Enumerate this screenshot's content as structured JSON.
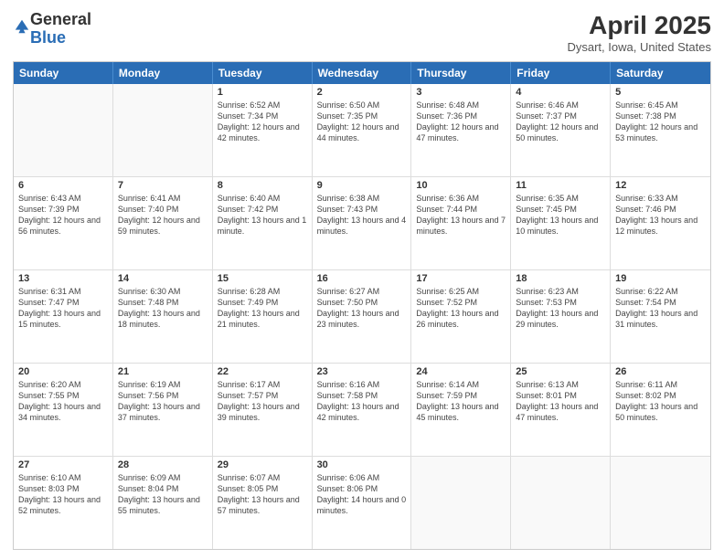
{
  "logo": {
    "general": "General",
    "blue": "Blue"
  },
  "title": "April 2025",
  "subtitle": "Dysart, Iowa, United States",
  "headers": [
    "Sunday",
    "Monday",
    "Tuesday",
    "Wednesday",
    "Thursday",
    "Friday",
    "Saturday"
  ],
  "rows": [
    [
      {
        "day": "",
        "info": ""
      },
      {
        "day": "",
        "info": ""
      },
      {
        "day": "1",
        "info": "Sunrise: 6:52 AM\nSunset: 7:34 PM\nDaylight: 12 hours and 42 minutes."
      },
      {
        "day": "2",
        "info": "Sunrise: 6:50 AM\nSunset: 7:35 PM\nDaylight: 12 hours and 44 minutes."
      },
      {
        "day": "3",
        "info": "Sunrise: 6:48 AM\nSunset: 7:36 PM\nDaylight: 12 hours and 47 minutes."
      },
      {
        "day": "4",
        "info": "Sunrise: 6:46 AM\nSunset: 7:37 PM\nDaylight: 12 hours and 50 minutes."
      },
      {
        "day": "5",
        "info": "Sunrise: 6:45 AM\nSunset: 7:38 PM\nDaylight: 12 hours and 53 minutes."
      }
    ],
    [
      {
        "day": "6",
        "info": "Sunrise: 6:43 AM\nSunset: 7:39 PM\nDaylight: 12 hours and 56 minutes."
      },
      {
        "day": "7",
        "info": "Sunrise: 6:41 AM\nSunset: 7:40 PM\nDaylight: 12 hours and 59 minutes."
      },
      {
        "day": "8",
        "info": "Sunrise: 6:40 AM\nSunset: 7:42 PM\nDaylight: 13 hours and 1 minute."
      },
      {
        "day": "9",
        "info": "Sunrise: 6:38 AM\nSunset: 7:43 PM\nDaylight: 13 hours and 4 minutes."
      },
      {
        "day": "10",
        "info": "Sunrise: 6:36 AM\nSunset: 7:44 PM\nDaylight: 13 hours and 7 minutes."
      },
      {
        "day": "11",
        "info": "Sunrise: 6:35 AM\nSunset: 7:45 PM\nDaylight: 13 hours and 10 minutes."
      },
      {
        "day": "12",
        "info": "Sunrise: 6:33 AM\nSunset: 7:46 PM\nDaylight: 13 hours and 12 minutes."
      }
    ],
    [
      {
        "day": "13",
        "info": "Sunrise: 6:31 AM\nSunset: 7:47 PM\nDaylight: 13 hours and 15 minutes."
      },
      {
        "day": "14",
        "info": "Sunrise: 6:30 AM\nSunset: 7:48 PM\nDaylight: 13 hours and 18 minutes."
      },
      {
        "day": "15",
        "info": "Sunrise: 6:28 AM\nSunset: 7:49 PM\nDaylight: 13 hours and 21 minutes."
      },
      {
        "day": "16",
        "info": "Sunrise: 6:27 AM\nSunset: 7:50 PM\nDaylight: 13 hours and 23 minutes."
      },
      {
        "day": "17",
        "info": "Sunrise: 6:25 AM\nSunset: 7:52 PM\nDaylight: 13 hours and 26 minutes."
      },
      {
        "day": "18",
        "info": "Sunrise: 6:23 AM\nSunset: 7:53 PM\nDaylight: 13 hours and 29 minutes."
      },
      {
        "day": "19",
        "info": "Sunrise: 6:22 AM\nSunset: 7:54 PM\nDaylight: 13 hours and 31 minutes."
      }
    ],
    [
      {
        "day": "20",
        "info": "Sunrise: 6:20 AM\nSunset: 7:55 PM\nDaylight: 13 hours and 34 minutes."
      },
      {
        "day": "21",
        "info": "Sunrise: 6:19 AM\nSunset: 7:56 PM\nDaylight: 13 hours and 37 minutes."
      },
      {
        "day": "22",
        "info": "Sunrise: 6:17 AM\nSunset: 7:57 PM\nDaylight: 13 hours and 39 minutes."
      },
      {
        "day": "23",
        "info": "Sunrise: 6:16 AM\nSunset: 7:58 PM\nDaylight: 13 hours and 42 minutes."
      },
      {
        "day": "24",
        "info": "Sunrise: 6:14 AM\nSunset: 7:59 PM\nDaylight: 13 hours and 45 minutes."
      },
      {
        "day": "25",
        "info": "Sunrise: 6:13 AM\nSunset: 8:01 PM\nDaylight: 13 hours and 47 minutes."
      },
      {
        "day": "26",
        "info": "Sunrise: 6:11 AM\nSunset: 8:02 PM\nDaylight: 13 hours and 50 minutes."
      }
    ],
    [
      {
        "day": "27",
        "info": "Sunrise: 6:10 AM\nSunset: 8:03 PM\nDaylight: 13 hours and 52 minutes."
      },
      {
        "day": "28",
        "info": "Sunrise: 6:09 AM\nSunset: 8:04 PM\nDaylight: 13 hours and 55 minutes."
      },
      {
        "day": "29",
        "info": "Sunrise: 6:07 AM\nSunset: 8:05 PM\nDaylight: 13 hours and 57 minutes."
      },
      {
        "day": "30",
        "info": "Sunrise: 6:06 AM\nSunset: 8:06 PM\nDaylight: 14 hours and 0 minutes."
      },
      {
        "day": "",
        "info": ""
      },
      {
        "day": "",
        "info": ""
      },
      {
        "day": "",
        "info": ""
      }
    ]
  ]
}
